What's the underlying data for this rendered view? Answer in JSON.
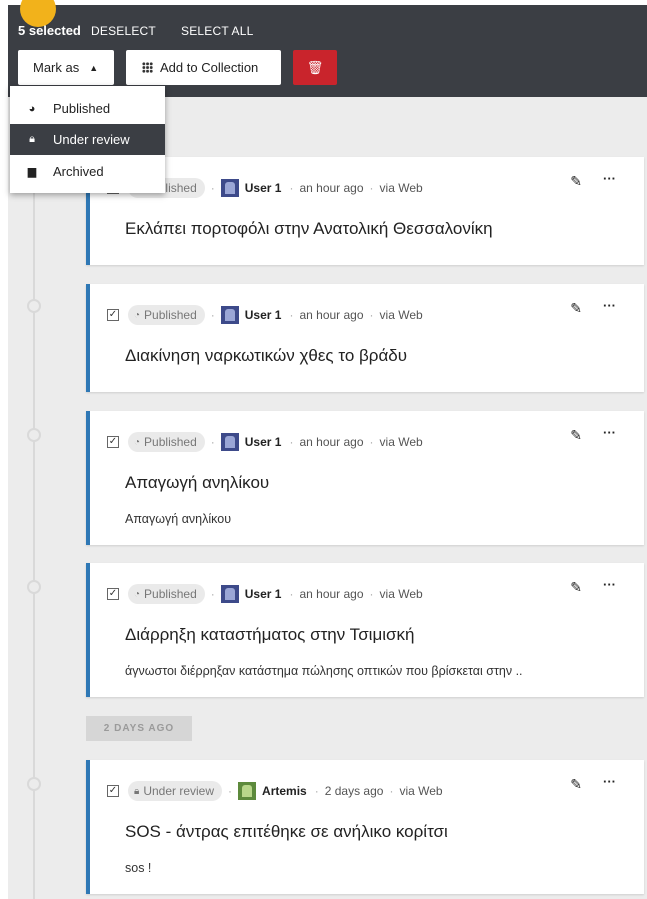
{
  "toolbar": {
    "selected_label": "5 selected",
    "deselect_label": "DESELECT",
    "select_all_label": "SELECT ALL",
    "mark_as_label": "Mark as",
    "add_collection_label": "Add to Collection",
    "delete_color": "#c9242c"
  },
  "mark_menu": {
    "items": [
      {
        "label": "Published",
        "icon": "globe-icon"
      },
      {
        "label": "Under review",
        "icon": "lock-icon",
        "active": true
      },
      {
        "label": "Archived",
        "icon": "archive-icon"
      }
    ]
  },
  "group_label": "2 DAYS AGO",
  "posts": [
    {
      "status": "Published",
      "user": "User 1",
      "time": "an hour ago",
      "via": "via Web",
      "title": "Εκλάπει πορτοφόλι στην Ανατολική Θεσσαλονίκη",
      "body": ""
    },
    {
      "status": "Published",
      "user": "User 1",
      "time": "an hour ago",
      "via": "via Web",
      "title": "Διακίνηση ναρκωτικών χθες το βράδυ",
      "body": ""
    },
    {
      "status": "Published",
      "user": "User 1",
      "time": "an hour ago",
      "via": "via Web",
      "title": "Απαγωγή ανηλίκου",
      "body": "Απαγωγή ανηλίκου"
    },
    {
      "status": "Published",
      "user": "User 1",
      "time": "an hour ago",
      "via": "via Web",
      "title": "Διάρρηξη καταστήματος στην Τσιμισκή",
      "body": "άγνωστοι διέρρηξαν κατάστημα πώλησης οπτικών που βρίσκεται στην .."
    },
    {
      "status": "Under review",
      "user": "Artemis",
      "time": "2 days ago",
      "via": "via Web",
      "title": "SOS - άντρας επιτέθηκε σε ανήλικο κορίτσι",
      "body": "sos !"
    }
  ],
  "colors": {
    "accent": "#2f78b5",
    "toolbar_bg": "#3b3e44",
    "timeline_bg": "#ececec"
  }
}
